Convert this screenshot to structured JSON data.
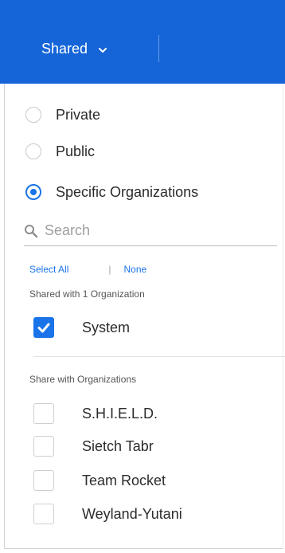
{
  "header": {
    "shared_label": "Shared",
    "accent_color": "#1565d8"
  },
  "visibility": {
    "options": [
      {
        "label": "Private",
        "checked": false
      },
      {
        "label": "Public",
        "checked": false
      },
      {
        "label": "Specific Organizations",
        "checked": true
      }
    ]
  },
  "search": {
    "placeholder": "Search",
    "icon": "search-icon"
  },
  "selection_links": {
    "select_all": "Select All",
    "separator": "|",
    "none": "None"
  },
  "shared_section": {
    "title": "Shared with 1 Organization",
    "items": [
      {
        "label": "System",
        "checked": true
      }
    ]
  },
  "share_section": {
    "title": "Share with Organizations",
    "items": [
      {
        "label": "S.H.I.E.L.D.",
        "checked": false
      },
      {
        "label": "Sietch Tabr",
        "checked": false
      },
      {
        "label": "Team Rocket",
        "checked": false
      },
      {
        "label": "Weyland-Yutani",
        "checked": false
      }
    ]
  }
}
